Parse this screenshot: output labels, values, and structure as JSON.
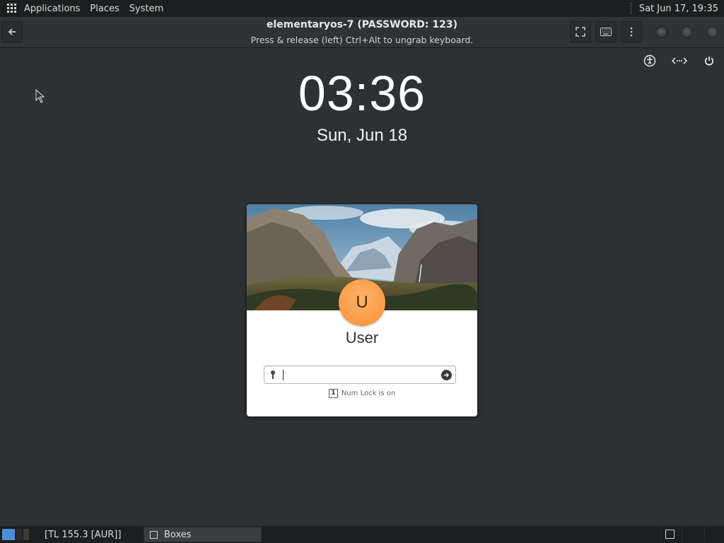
{
  "top_panel": {
    "menus": [
      "Applications",
      "Places",
      "System"
    ],
    "clock": "Sat Jun 17, 19:35"
  },
  "headerbar": {
    "title": "elementaryos-7 (PASSWORD: 123)",
    "subtitle": "Press & release (left) Ctrl+Alt to ungrab keyboard.",
    "buttons": [
      "back-icon",
      "fullscreen-icon",
      "keyboard-icon",
      "menu-dots-icon"
    ]
  },
  "greeter": {
    "indicators": [
      "accessibility-icon",
      "keyboard-layout-icon",
      "power-icon"
    ],
    "time": "03:36",
    "date": "Sun, Jun 18",
    "avatar_initial": "U",
    "username": "User",
    "password_value": "",
    "numlock_indicator": "1",
    "numlock_text": "Num Lock is on",
    "avatar_color": "#fb9a45"
  },
  "bottom_panel": {
    "tasks": [
      {
        "label": "[TL 155.3 [AUR]]",
        "active": false
      },
      {
        "label": "Boxes",
        "active": true
      }
    ]
  },
  "colors": {
    "desktop": "#2e3133",
    "panel": "#1c1e1f",
    "card": "#ffffff"
  }
}
